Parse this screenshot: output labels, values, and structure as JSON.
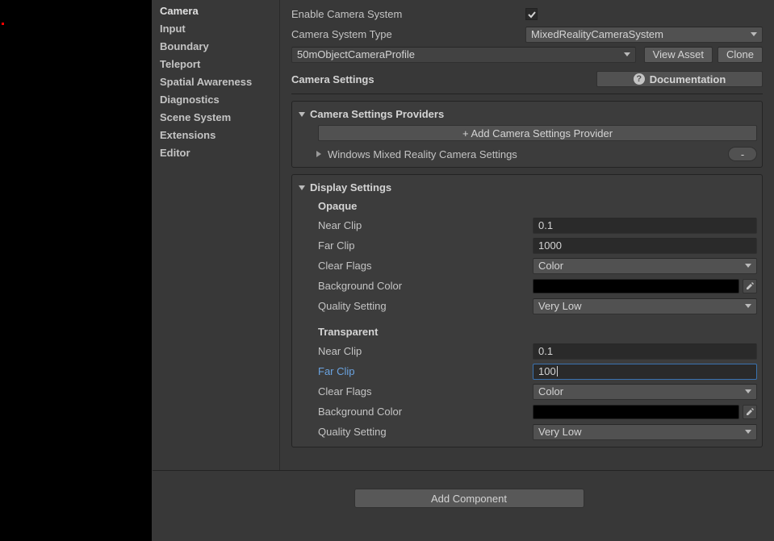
{
  "sidebar": {
    "items": [
      {
        "label": "Camera",
        "active": true
      },
      {
        "label": "Input"
      },
      {
        "label": "Boundary"
      },
      {
        "label": "Teleport"
      },
      {
        "label": "Spatial Awareness"
      },
      {
        "label": "Diagnostics"
      },
      {
        "label": "Scene System"
      },
      {
        "label": "Extensions"
      },
      {
        "label": "Editor"
      }
    ]
  },
  "header": {
    "enable_label": "Enable Camera System",
    "enable_checked": true,
    "type_label": "Camera System Type",
    "type_value": "MixedRealityCameraSystem",
    "profile_value": "50mObjectCameraProfile",
    "view_asset_label": "View Asset",
    "clone_label": "Clone",
    "settings_label": "Camera Settings",
    "documentation_label": "Documentation"
  },
  "providers": {
    "title": "Camera Settings Providers",
    "add_label": "+ Add Camera Settings Provider",
    "item_label": "Windows Mixed Reality Camera Settings",
    "minus_label": "-"
  },
  "display": {
    "title": "Display Settings",
    "opaque": {
      "title": "Opaque",
      "near_clip_label": "Near Clip",
      "near_clip_value": "0.1",
      "far_clip_label": "Far Clip",
      "far_clip_value": "1000",
      "clear_flags_label": "Clear Flags",
      "clear_flags_value": "Color",
      "bg_color_label": "Background Color",
      "bg_color_value": "#000000",
      "quality_label": "Quality Setting",
      "quality_value": "Very Low"
    },
    "transparent": {
      "title": "Transparent",
      "near_clip_label": "Near Clip",
      "near_clip_value": "0.1",
      "far_clip_label": "Far Clip",
      "far_clip_value": "100",
      "clear_flags_label": "Clear Flags",
      "clear_flags_value": "Color",
      "bg_color_label": "Background Color",
      "bg_color_value": "#000000",
      "quality_label": "Quality Setting",
      "quality_value": "Very Low"
    }
  },
  "footer": {
    "add_component_label": "Add Component"
  }
}
